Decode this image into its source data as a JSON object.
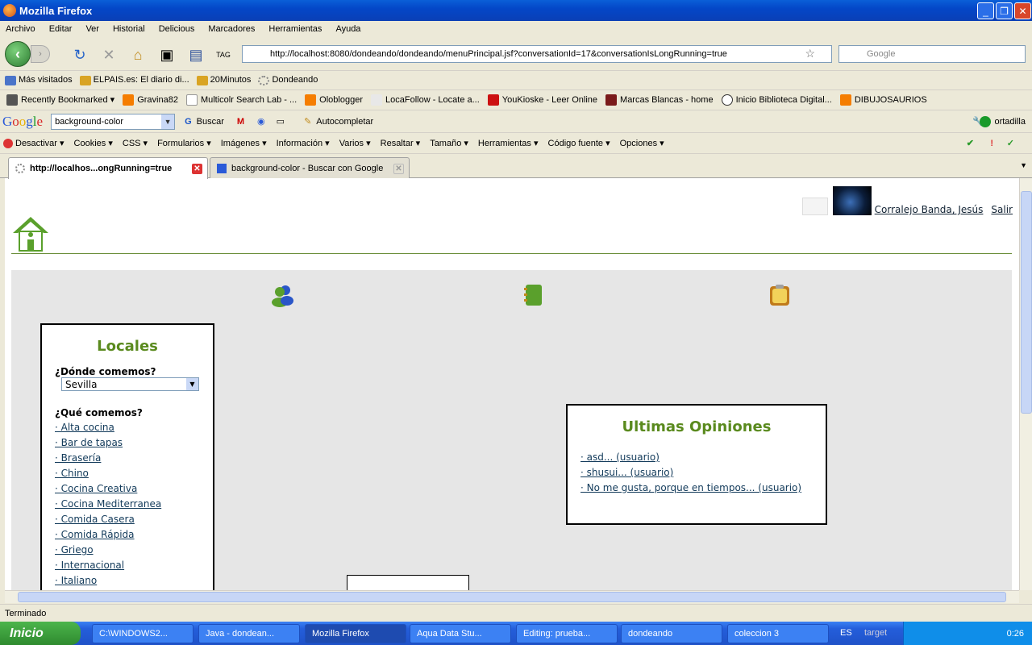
{
  "window": {
    "title": "Mozilla Firefox"
  },
  "menu": [
    "Archivo",
    "Editar",
    "Ver",
    "Historial",
    "Delicious",
    "Marcadores",
    "Herramientas",
    "Ayuda"
  ],
  "nav": {
    "url": "http://localhost:8080/dondeando/dondeando/menuPrincipal.jsf?conversationId=17&conversationIsLongRunning=true",
    "search_placeholder": "Google"
  },
  "bookmarks": [
    "Más visitados",
    "ELPAIS.es: El diario di...",
    "20Minutos",
    "Dondeando"
  ],
  "recent": [
    "Recently Bookmarked",
    "Gravina82",
    "Multicolr Search Lab - ...",
    "Oloblogger",
    "LocaFollow - Locate a...",
    "YouKioske - Leer Online",
    "Marcas Blancas - home",
    "Inicio Biblioteca Digital...",
    "DIBUJOSAURIOS"
  ],
  "googlebar": {
    "logo": "Google",
    "query": "background-color",
    "buscar": "Buscar",
    "autocompletar": "Autocompletar",
    "user": "ortadilla"
  },
  "devbar": [
    "Desactivar",
    "Cookies",
    "CSS",
    "Formularios",
    "Imágenes",
    "Información",
    "Varios",
    "Resaltar",
    "Tamaño",
    "Herramientas",
    "Código fuente",
    "Opciones"
  ],
  "tabs": [
    {
      "label": "http://localhos...ongRunning=true"
    },
    {
      "label": "background-color - Buscar con Google"
    }
  ],
  "page": {
    "user_name": "Corralejo Banda, Jesús",
    "logout": "Salir",
    "locales": {
      "title": "Locales",
      "where_label": "¿Dónde comemos?",
      "where_value": "Sevilla",
      "what_label": "¿Qué comemos?",
      "categories": [
        "· Alta cocina",
        "· Bar de tapas",
        "· Brasería",
        "· Chino",
        "· Cocina Creativa",
        "· Cocina Mediterranea",
        "· Comida Casera",
        "· Comida Rápida",
        "· Griego",
        "· Internacional",
        "· Italiano"
      ]
    },
    "opiniones": {
      "title": "Ultimas Opiniones",
      "items": [
        "· asd... (usuario)",
        "· shusui... (usuario)",
        "· No me gusta, porque en tiempos... (usuario)"
      ]
    }
  },
  "status": {
    "text": "Terminado"
  },
  "taskbar": {
    "start": "Inicio",
    "tasks": [
      "C:\\WINDOWS2...",
      "Java - dondean...",
      "Mozilla Firefox",
      "Aqua Data Stu...",
      "Editing: prueba...",
      "dondeando",
      "coleccion 3"
    ],
    "lang": "ES",
    "target": "target",
    "time": "0:26"
  }
}
